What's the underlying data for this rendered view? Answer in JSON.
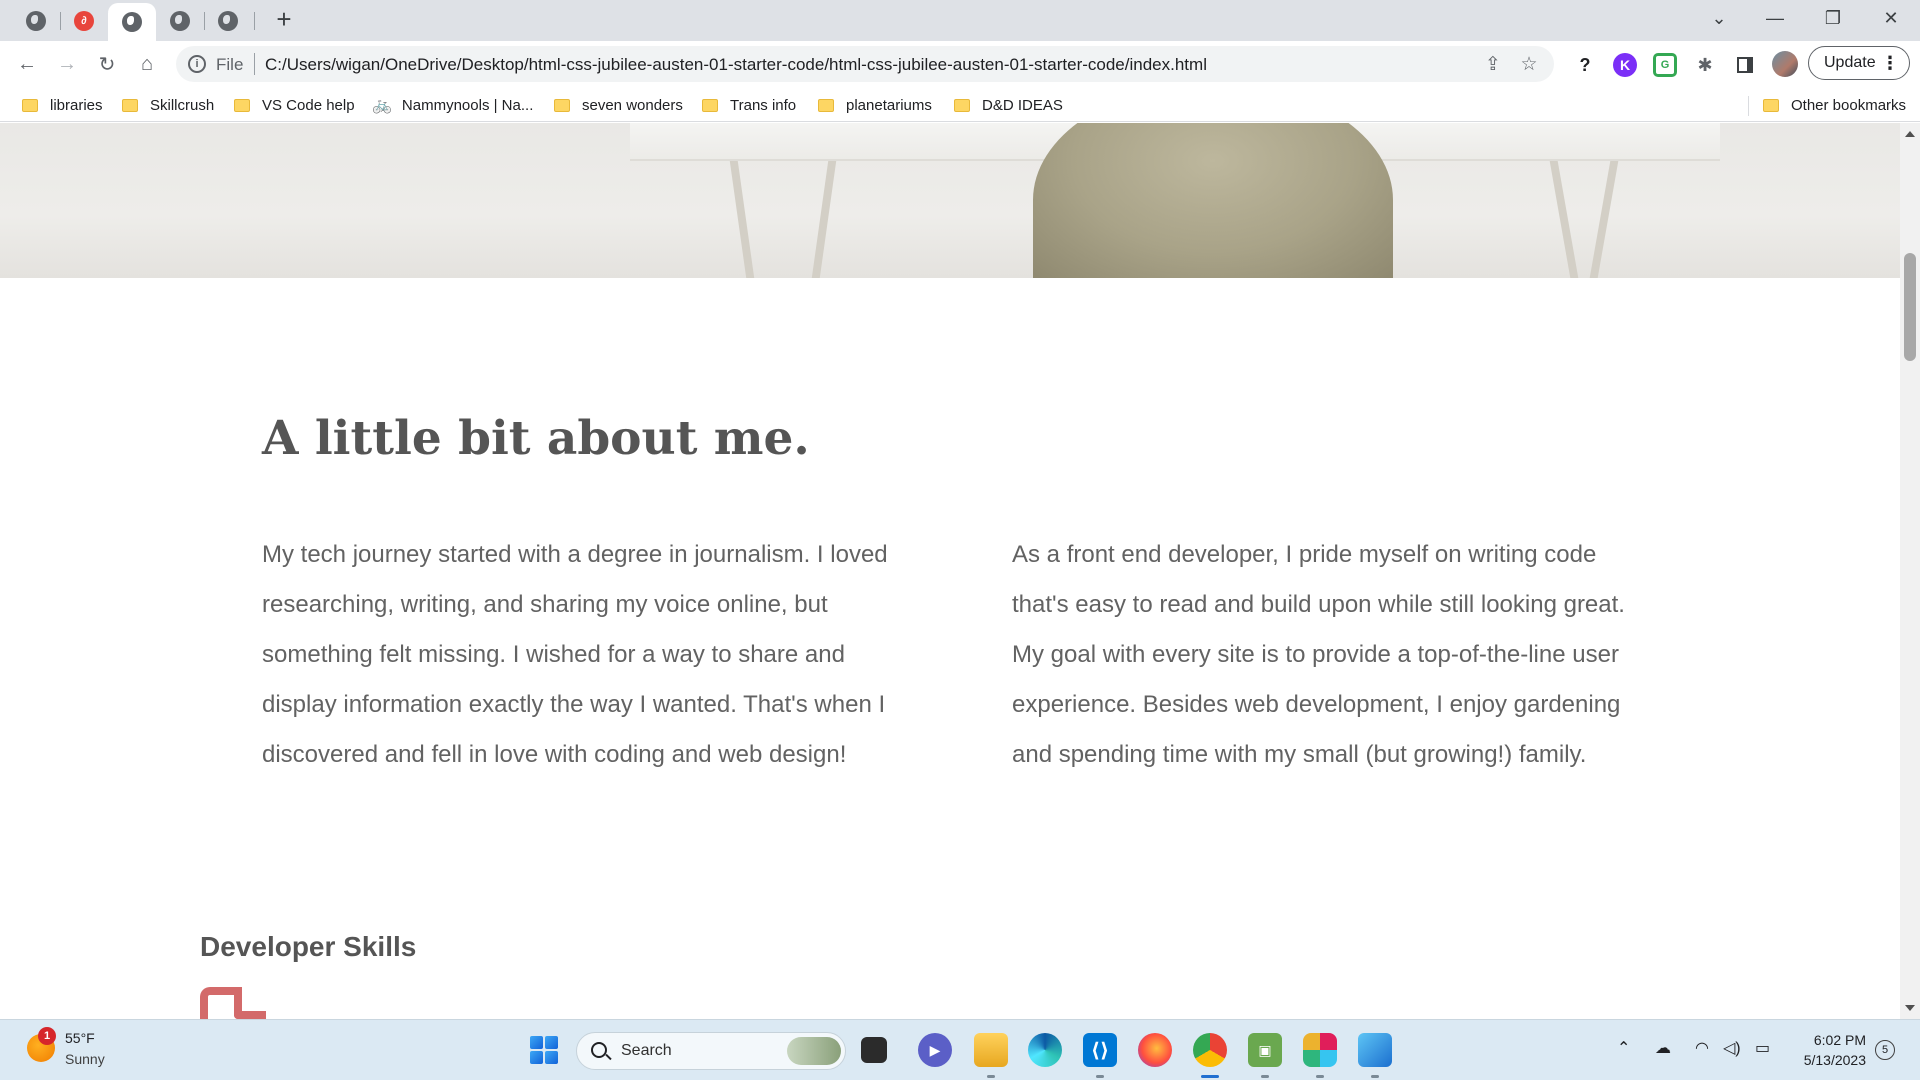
{
  "browser": {
    "new_tab_symbol": "+",
    "url_scheme_label": "File",
    "url": "C:/Users/wigan/OneDrive/Desktop/html-css-jubilee-austen-01-starter-code/html-css-jubilee-austen-01-starter-code/index.html",
    "update_label": "Update",
    "info_glyph": "i",
    "ext_k_label": "K",
    "ext_g_label": "G"
  },
  "bookmarks": {
    "items": [
      {
        "label": "libraries",
        "icon": "folder-icon"
      },
      {
        "label": "Skillcrush",
        "icon": "folder-icon"
      },
      {
        "label": "VS Code help",
        "icon": "folder-icon"
      },
      {
        "label": "Nammynools | Na...",
        "icon": "bike-icon"
      },
      {
        "label": "seven wonders",
        "icon": "folder-icon"
      },
      {
        "label": "Trans info",
        "icon": "folder-icon"
      },
      {
        "label": "planetariums",
        "icon": "folder-icon"
      },
      {
        "label": "D&D IDEAS",
        "icon": "folder-icon"
      }
    ],
    "other": "Other bookmarks"
  },
  "page": {
    "about_title": "A little bit about me.",
    "about_left": "My tech journey started with a degree in journalism. I loved researching, writing, and sharing my voice online, but something felt missing. I wished for a way to share and display information exactly the way I wanted. That's when I discovered and fell in love with coding and web design!",
    "about_right": "As a front end developer, I pride myself on writing code that's easy to read and build upon while still looking great. My goal with every site is to provide a top-of-the-line user experience. Besides web development, I enjoy gardening and spending time with my small (but growing!) family.",
    "skills_title": "Developer Skills"
  },
  "taskbar": {
    "weather_badge": "1",
    "weather_temp": "55°F",
    "weather_cond": "Sunny",
    "search_label": "Search",
    "time": "6:02 PM",
    "date": "5/13/2023",
    "notification_count": "5"
  },
  "colors": {
    "heading": "#555555",
    "body_text": "#626262",
    "skill_icon_red": "#d36a6a",
    "taskbar_bg": "#dbe9f3"
  }
}
